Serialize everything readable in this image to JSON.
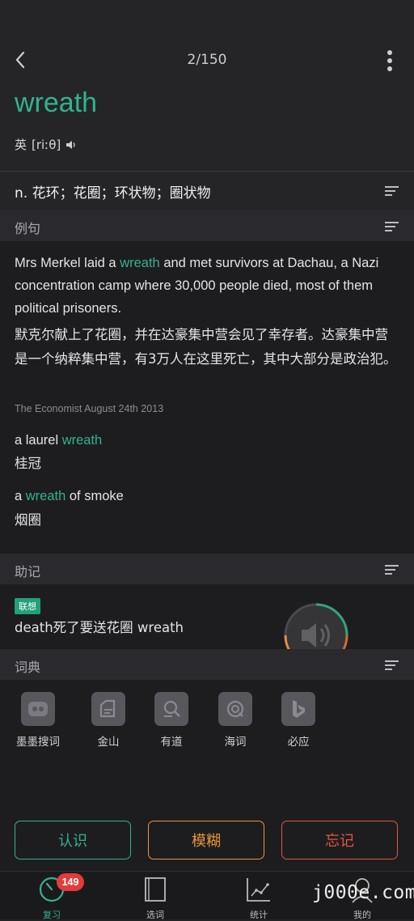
{
  "nav": {
    "counter": "2/150"
  },
  "word": {
    "text": "wreath",
    "phonetic_label": "英",
    "phonetic": "[riːθ]"
  },
  "definition": "n. 花环；花圈；环状物；圈状物",
  "examples": {
    "title": "例句",
    "items": [
      {
        "en_before": "Mrs Merkel laid a ",
        "en_word": "wreath",
        "en_after": " and met survivors at Dachau, a Nazi concentration camp where 30,000 people died, most of them political prisoners.",
        "zh": "默克尔献上了花圈，并在达豪集中营会见了幸存者。达豪集中营是一个纳粹集中营，有3万人在这里死亡，其中大部分是政治犯。",
        "source": "The Economist August 24th 2013"
      }
    ],
    "phrases": [
      {
        "before": "a laurel ",
        "word": "wreath",
        "after": "",
        "zh": "桂冠"
      },
      {
        "before": "a ",
        "word": "wreath",
        "after": " of smoke",
        "zh": "烟圈"
      }
    ]
  },
  "mnemonic": {
    "title": "助记",
    "tag": "联想",
    "text": "death死了要送花圈 wreath"
  },
  "dictionaries": {
    "title": "词典",
    "items": [
      {
        "label": "墨墨搜词",
        "icon": "momo-face-icon"
      },
      {
        "label": "金山",
        "icon": "jinshan-icon"
      },
      {
        "label": "有道",
        "icon": "youdao-icon"
      },
      {
        "label": "海词",
        "icon": "haici-icon"
      },
      {
        "label": "必应",
        "icon": "bing-icon"
      }
    ]
  },
  "actions": {
    "know": "认识",
    "vague": "模糊",
    "forget": "忘记"
  },
  "tabs": [
    {
      "label": "复习",
      "badge": "149"
    },
    {
      "label": "选词"
    },
    {
      "label": "统计"
    },
    {
      "label": "我的"
    }
  ],
  "watermark": "j000e.com",
  "colors": {
    "accent": "#33b28e",
    "vague": "#e8973a",
    "forget": "#e2553f",
    "badge": "#e23b3b"
  }
}
